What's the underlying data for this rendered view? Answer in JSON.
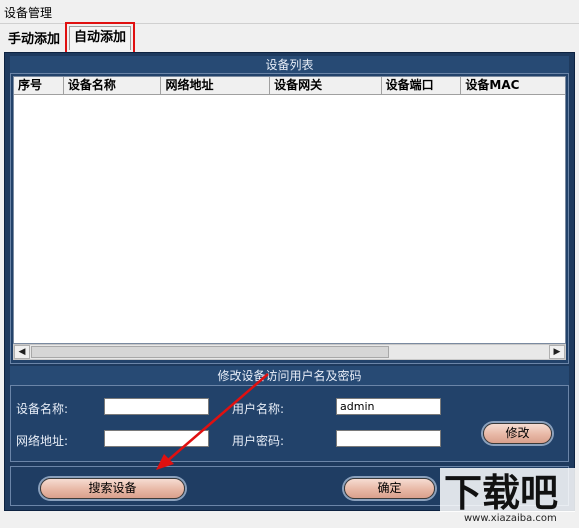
{
  "window": {
    "title": "设备管理"
  },
  "tabs": [
    {
      "label": "手动添加"
    },
    {
      "label": "自动添加"
    }
  ],
  "device_list": {
    "title": "设备列表",
    "columns": [
      "序号",
      "设备名称",
      "网络地址",
      "设备网关",
      "设备端口",
      "设备MAC"
    ],
    "rows": []
  },
  "credentials": {
    "title": "修改设备访问用户名及密码",
    "device_name_label": "设备名称:",
    "device_name_value": "",
    "network_address_label": "网络地址:",
    "network_address_value": "",
    "username_label": "用户名称:",
    "username_value": "admin",
    "password_label": "用户密码:",
    "password_value": "",
    "modify_button": "修改"
  },
  "actions": {
    "search_button": "搜索设备",
    "ok_button": "确定"
  },
  "scrollbar": {
    "left_arrow": "◀",
    "right_arrow": "▶"
  },
  "watermark": {
    "logo_text": "下载吧",
    "url": "www.xiazaiba.com"
  },
  "colors": {
    "panel_bg": "#1e3a5e",
    "highlight_border": "#e01010",
    "annotation_arrow": "#e01010",
    "button_fill": "#e8b8a6"
  }
}
